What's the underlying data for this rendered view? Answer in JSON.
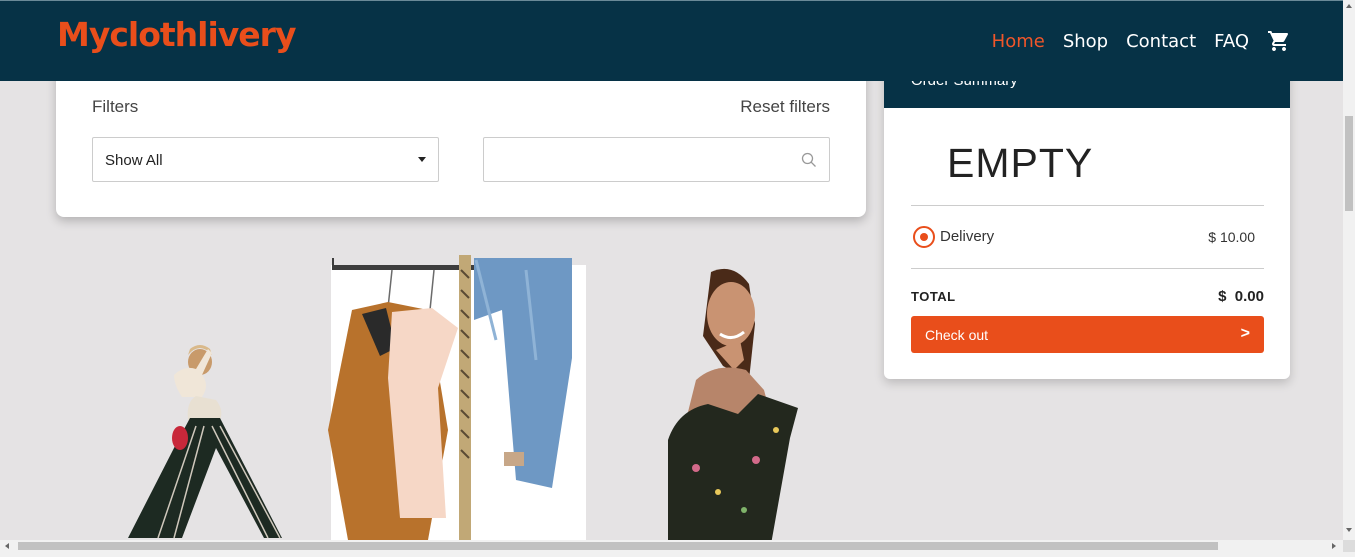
{
  "brand": {
    "name": "Myclothlivery",
    "color": "#e94e1b"
  },
  "nav": {
    "items": [
      {
        "label": "Home",
        "active": true
      },
      {
        "label": "Shop",
        "active": false
      },
      {
        "label": "Contact",
        "active": false
      },
      {
        "label": "FAQ",
        "active": false
      }
    ],
    "cart_icon": "cart-icon"
  },
  "filters": {
    "title": "Filters",
    "reset_label": "Reset filters",
    "category_select": {
      "value": "Show All"
    },
    "search": {
      "value": "",
      "placeholder": "",
      "icon": "search-icon"
    }
  },
  "order_summary": {
    "title": "Order Summary",
    "empty_text": "EMPTY",
    "delivery": {
      "label": "Delivery",
      "price": "$ 10.00",
      "selected": true
    },
    "total": {
      "label": "TOTAL",
      "value": "$  0.00"
    },
    "checkout": {
      "label": "Check out",
      "arrow": ">"
    }
  },
  "colors": {
    "navbar": "#063246",
    "accent": "#e94e1b",
    "page_background": "#e5e3e4"
  }
}
